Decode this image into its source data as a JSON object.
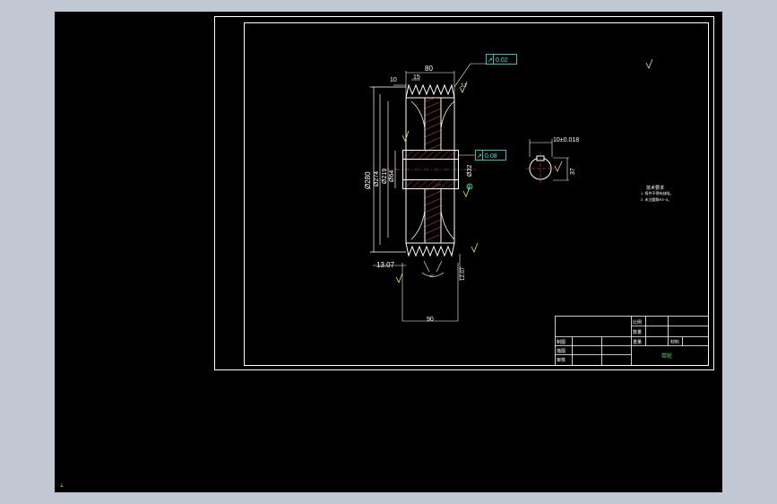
{
  "colors": {
    "background": "#000000",
    "line": "#ffffff",
    "dimension": "#ffffff",
    "tolerance": "#33f3e4",
    "hatch": "#ff4646",
    "note": "#f0f04a",
    "title_green": "#3fe66b"
  },
  "dimensions": {
    "top_width": "80",
    "groove_pitch": "15",
    "groove_offset": "10",
    "dia_outer": "Ø280",
    "dia_274": "Ø274",
    "dia_2": "Ø219",
    "dia_3": "Ø64",
    "dia_bore": "Ø32",
    "left_offset": "13.07",
    "groove_depth": "12.07",
    "bottom_width": "90",
    "groove_angle": "40°",
    "keyway_width": "10±0.018",
    "keyway_depth": "37"
  },
  "tolerances": {
    "runout_top": "0.02",
    "runout_mid": "0.08",
    "datum": "A"
  },
  "roughness_label": "3.2",
  "notes": {
    "title": "技术要求",
    "items": [
      "1. 铸件不得有缺陷。",
      "2. 未注圆角R3~5。"
    ]
  },
  "title_block": {
    "scale_label": "比例",
    "quantity_label": "数量",
    "drawn_label": "制图",
    "weight_label": "重量",
    "material_label": "材料",
    "check_label": "描图",
    "review_label": "审核",
    "part_name": "带轮"
  },
  "ucs_icon": "ucs-icon"
}
